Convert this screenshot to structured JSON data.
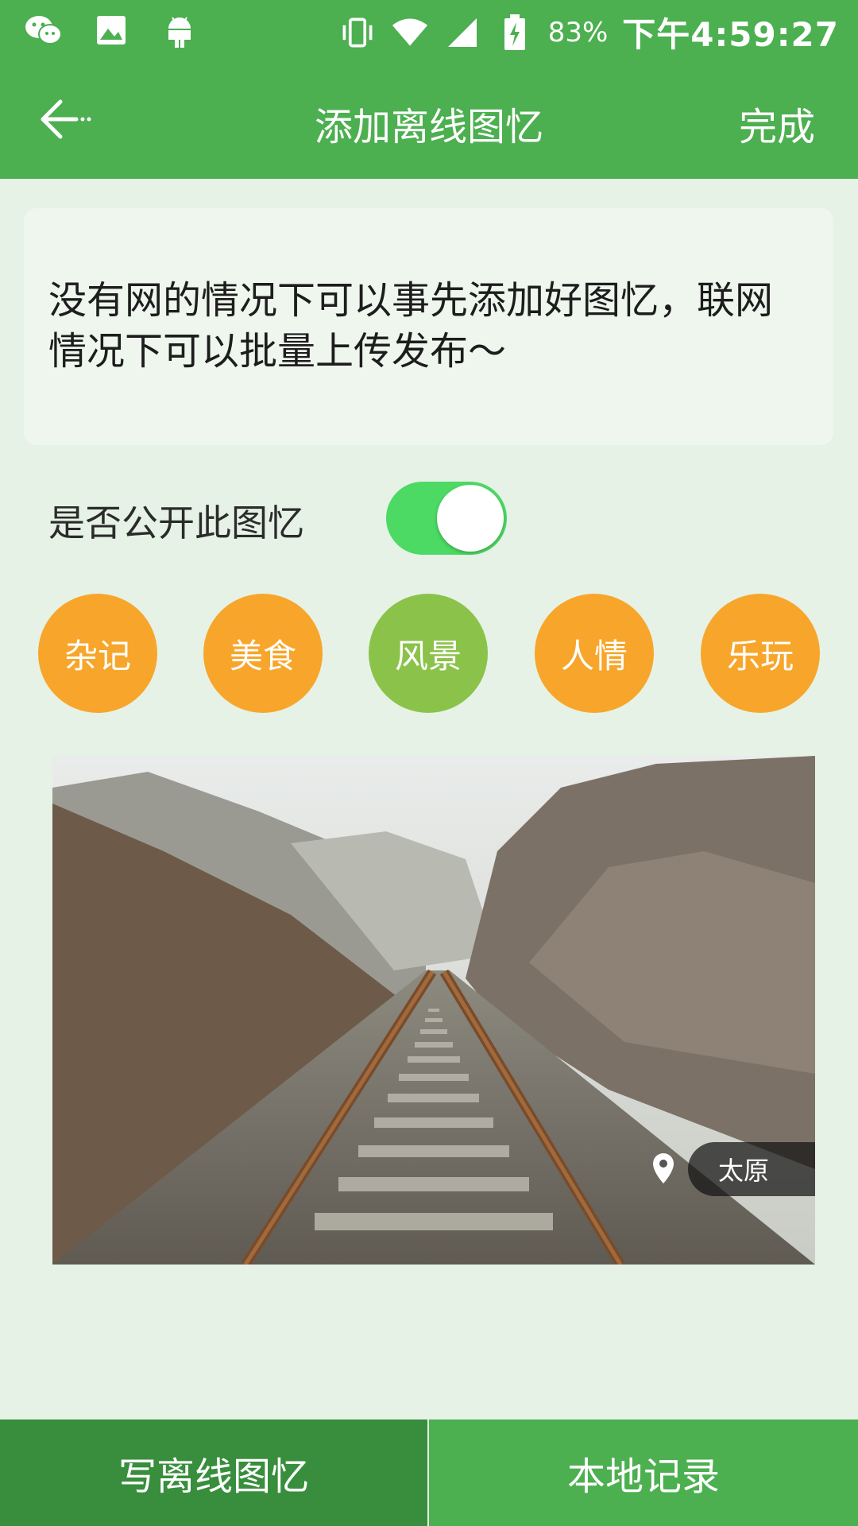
{
  "status_bar": {
    "battery_pct": "83%",
    "time": "下午4:59:27"
  },
  "app_bar": {
    "title": "添加离线图忆",
    "done_label": "完成"
  },
  "note": {
    "text": "没有网的情况下可以事先添加好图忆，联网情况下可以批量上传发布～"
  },
  "public_toggle": {
    "label": "是否公开此图忆",
    "on": true
  },
  "categories": [
    {
      "label": "杂记",
      "color": "#f7a62b"
    },
    {
      "label": "美食",
      "color": "#f7a62b"
    },
    {
      "label": "风景",
      "color": "#8bc34a"
    },
    {
      "label": "人情",
      "color": "#f7a62b"
    },
    {
      "label": "乐玩",
      "color": "#f7a62b"
    }
  ],
  "photo": {
    "location": "太原"
  },
  "bottom_tabs": [
    {
      "label": "写离线图忆",
      "active": true,
      "color": "#388e3c"
    },
    {
      "label": "本地记录",
      "active": false,
      "color": "#4caf50"
    }
  ]
}
